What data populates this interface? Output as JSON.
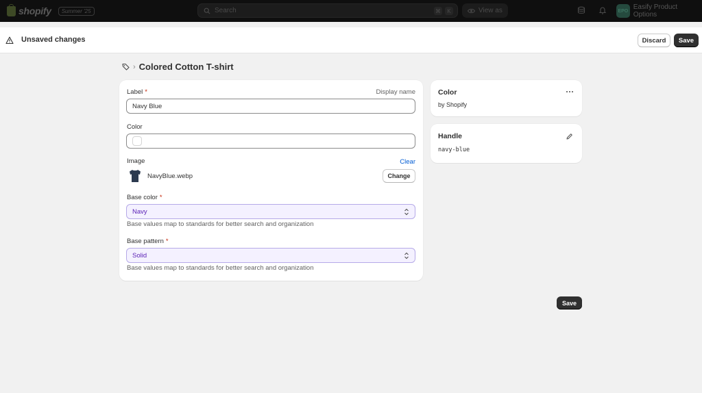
{
  "topbar": {
    "brand": "shopify",
    "edition": "Summer '25",
    "search_placeholder": "Search",
    "shortcut_keys": [
      "⌘",
      "K"
    ],
    "view_as_label": "View as",
    "store_initials": "EPO",
    "store_name": "Easify Product Options"
  },
  "unsaved_bar": {
    "title": "Unsaved changes",
    "discard_label": "Discard",
    "save_label": "Save"
  },
  "breadcrumb": {
    "icon": "tag-icon",
    "title": "Colored Cotton T-shirt"
  },
  "form": {
    "label_title": "Label",
    "label_aside": "Display name",
    "label_value": "Navy Blue",
    "color_title": "Color",
    "color_value": "",
    "image_title": "Image",
    "image_clear": "Clear",
    "image_file": "NavyBlue.webp",
    "image_change": "Change",
    "base_color_title": "Base color",
    "base_color_value": "Navy",
    "base_color_help": "Base values map to standards for better search and organization",
    "base_pattern_title": "Base pattern",
    "base_pattern_value": "Solid",
    "base_pattern_help": "Base values map to standards for better search and organization",
    "required_marker": "*"
  },
  "side": {
    "type_title": "Color",
    "type_sub": "by Shopify",
    "handle_title": "Handle",
    "handle_value": "navy-blue"
  },
  "footer": {
    "save_label": "Save"
  },
  "colors": {
    "primary_button": "#303030",
    "link": "#005bd3",
    "required": "#c5280c",
    "select_text": "#5b21b6",
    "select_bg": "#f4f1ff"
  }
}
